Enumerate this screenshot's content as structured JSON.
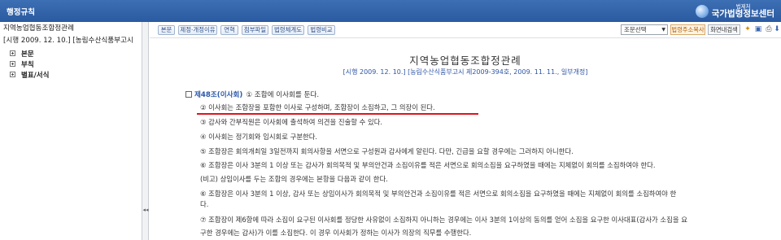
{
  "app": {
    "title": "행정규칙",
    "brand_small": "법제처",
    "brand_name": "국가법령정보센터"
  },
  "sidebar": {
    "law_title": "지역농업협동조합정관례",
    "law_meta": "[시행 2009. 12. 10.] [농림수산식품부고시",
    "items": [
      {
        "label": "본문"
      },
      {
        "label": "부칙"
      },
      {
        "label": "별표/서식"
      }
    ],
    "collapse_glyph": "◂◂"
  },
  "toolbar": {
    "buttons": [
      "본문",
      "제정·개정이유",
      "연혁",
      "첨부파일",
      "법령체계도",
      "법령비교"
    ],
    "select_value": "조문선택",
    "copy_label": "법령주소복사",
    "pane_label": "화면내검색"
  },
  "document": {
    "title": "지역농업협동조합정관례",
    "subtitle": "[시행 2009. 12. 10.] [농림수산식품부고시 제2009-394호, 2009. 11. 11., 일부개정]",
    "article_no": "제48조(이사회)",
    "article_first": "① 조합에 이사회를 둔다.",
    "paragraphs": [
      "② 이사회는 조합장을 포함한 이사로 구성하며, 조합장이 소집하고, 그 의장이 된다.",
      "③ 감사와 간부직원은 이사회에 출석하여 의견을 진술할 수 있다.",
      "④ 이사회는 정기회와 임시회로 구분한다.",
      "⑤ 조합장은 회의개최일 3일전까지 회의사항을 서면으로 구성원과 감사에게 알린다. 다만, 긴급을 요할 경우에는 그러하지 아니한다.",
      "⑥ 조합장은 이사 3분의 1 이상 또는 감사가 회의목적 및 부의안건과 소집이유를 적은 서면으로 회의소집을 요구하였을 때에는 지체없이 회의를 소집하여야 한다.",
      "(비고) 상임이사를 두는 조합의 경우에는 본항을 다음과 같이 한다.",
      "⑥ 조합장은 이사 3분의 1 이상, 감사 또는 상임이사가 회의목적 및 부의안건과 소집이유를 적은 서면으로 회의소집을 요구하였을 때에는 지체없이 회의를 소집하여야 한",
      "다.",
      "⑦ 조합장이 제6항에 따라 소집이 요구된 이사회를 정당한 사유없이 소집하지 아니하는 경우에는 이사 3분의 1이상의 동의를 얻어 소집을 요구한 이사대표(감사가 소집을 요",
      "구한 경우에는 감사)가 이를 소집한다. 이 경우 이사회가 정하는 이사가 의장의 직무를 수행한다."
    ]
  },
  "colors": {
    "header_blue": "#2a5aa0",
    "link_blue": "#2f55a5",
    "highlight_red": "#e0141e"
  }
}
